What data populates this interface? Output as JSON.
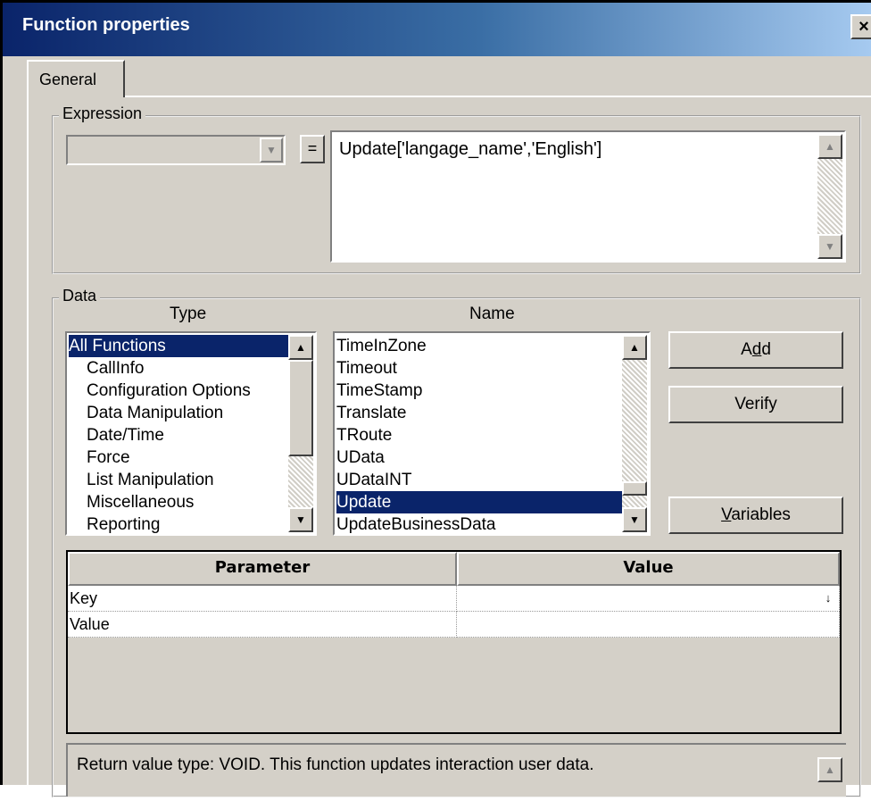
{
  "window": {
    "title": "Function properties",
    "close_label": "×"
  },
  "tabs": [
    {
      "label": "General",
      "selected": true
    }
  ],
  "expression": {
    "group_label": "Expression",
    "combo_value": "",
    "equals_label": "=",
    "text": "Update['langage_name','English']"
  },
  "data": {
    "group_label": "Data",
    "type_header": "Type",
    "name_header": "Name",
    "type_items": [
      "All Functions",
      "CallInfo",
      "Configuration Options",
      "Data Manipulation",
      "Date/Time",
      "Force",
      "List Manipulation",
      "Miscellaneous",
      "Reporting"
    ],
    "type_selected": "All Functions",
    "name_items": [
      "TimeInZone",
      "Timeout",
      "TimeStamp",
      "Translate",
      "TRoute",
      "UData",
      "UDataINT",
      "Update",
      "UpdateBusinessData"
    ],
    "name_selected": "Update",
    "buttons": {
      "add": {
        "pre": "A",
        "accel": "d",
        "post": "d"
      },
      "verify": {
        "pre": "Verify",
        "accel": "",
        "post": ""
      },
      "variables": {
        "pre": "",
        "accel": "V",
        "post": "ariables"
      }
    }
  },
  "params": {
    "columns": [
      "Parameter",
      "Value"
    ],
    "rows": [
      {
        "parameter": "Key",
        "value": "",
        "dropdown_icon": "dropdown-arrow"
      },
      {
        "parameter": "Value",
        "value": ""
      }
    ]
  },
  "description": {
    "text": "Return value type: VOID. This function updates interaction user data."
  },
  "colors": {
    "title_gradient_start": "#0a246a",
    "title_gradient_end": "#a6caf0",
    "selection": "#0a246a",
    "dialog_face": "#d4d0c8"
  }
}
